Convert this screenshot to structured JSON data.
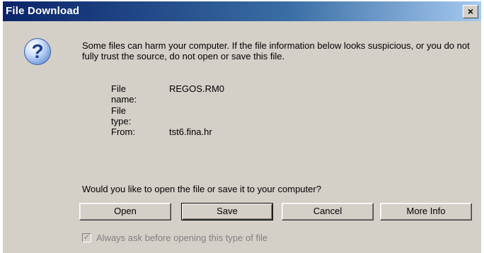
{
  "window": {
    "title": "File Download",
    "close_glyph": "×"
  },
  "dialog": {
    "icon": "question-icon",
    "message": "Some files can harm your computer. If the file information below looks suspicious, or you do not fully trust the source, do not open or save this file.",
    "file_name_label": "File name:",
    "file_name_value": "REGOS.RM0",
    "file_type_label": "File type:",
    "file_type_value": "",
    "from_label": "From:",
    "from_value": "tst6.fina.hr",
    "prompt": "Would you like to open the file or save it to your computer?"
  },
  "buttons": {
    "open": "Open",
    "save": "Save",
    "cancel": "Cancel",
    "more_info": "More Info"
  },
  "checkbox": {
    "label": "Always ask before opening this type of file",
    "checked": true,
    "disabled": true,
    "check_glyph": "✓"
  },
  "colors": {
    "titlebar_start": "#0a246a",
    "titlebar_end": "#a6caf0",
    "dialog_face": "#d4d0c8",
    "disabled_text": "#808080"
  }
}
